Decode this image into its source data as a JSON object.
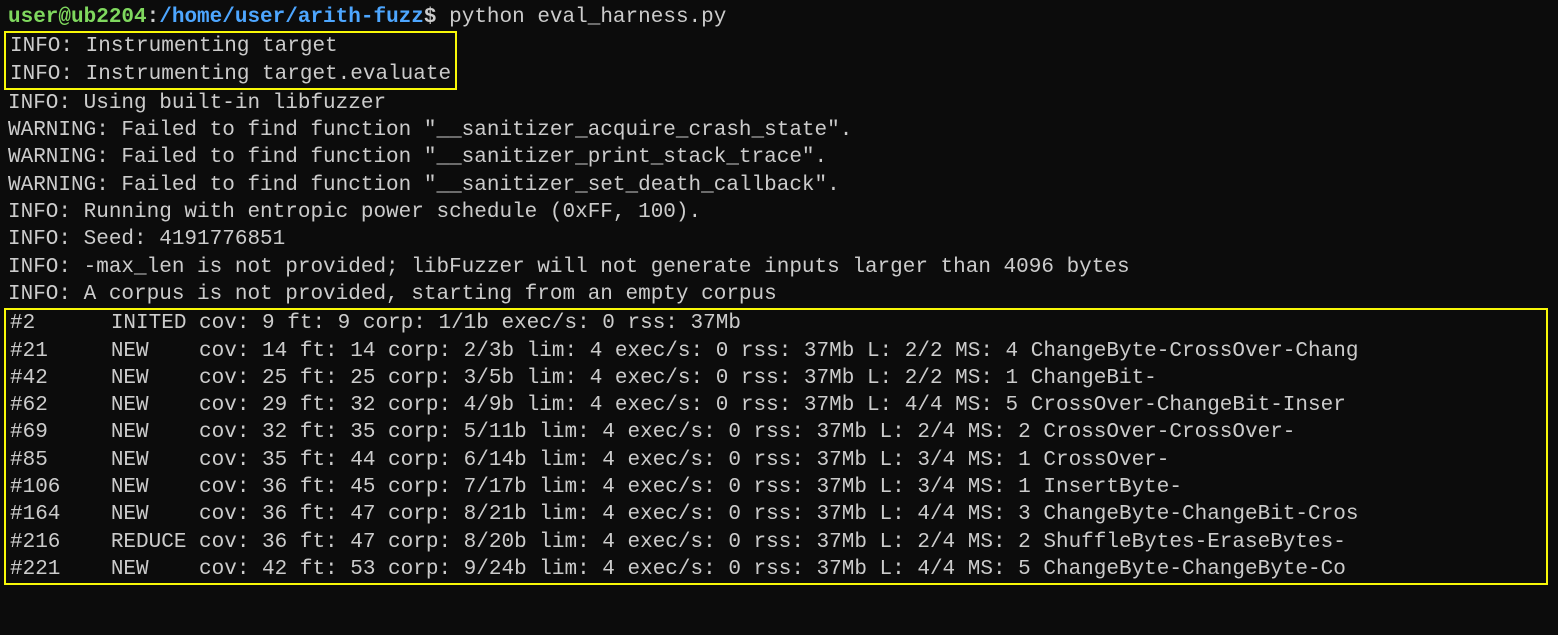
{
  "prompt": {
    "user_host": "user@ub2204",
    "colon": ":",
    "cwd": "/home/user/arith-fuzz",
    "dollar": "$ ",
    "command": "python eval_harness.py"
  },
  "box1": {
    "line1": "INFO: Instrumenting target",
    "line2": "INFO: Instrumenting target.evaluate"
  },
  "mid": {
    "l1": "INFO: Using built-in libfuzzer",
    "l2": "WARNING: Failed to find function \"__sanitizer_acquire_crash_state\".",
    "l3": "WARNING: Failed to find function \"__sanitizer_print_stack_trace\".",
    "l4": "WARNING: Failed to find function \"__sanitizer_set_death_callback\".",
    "l5": "INFO: Running with entropic power schedule (0xFF, 100).",
    "l6": "INFO: Seed: 4191776851",
    "l7": "INFO: -max_len is not provided; libFuzzer will not generate inputs larger than 4096 bytes",
    "l8": "INFO: A corpus is not provided, starting from an empty corpus"
  },
  "box2": {
    "r1": "#2      INITED cov: 9 ft: 9 corp: 1/1b exec/s: 0 rss: 37Mb",
    "r2": "#21     NEW    cov: 14 ft: 14 corp: 2/3b lim: 4 exec/s: 0 rss: 37Mb L: 2/2 MS: 4 ChangeByte-CrossOver-Chang",
    "r3": "#42     NEW    cov: 25 ft: 25 corp: 3/5b lim: 4 exec/s: 0 rss: 37Mb L: 2/2 MS: 1 ChangeBit-",
    "r4": "#62     NEW    cov: 29 ft: 32 corp: 4/9b lim: 4 exec/s: 0 rss: 37Mb L: 4/4 MS: 5 CrossOver-ChangeBit-Inser",
    "r5": "#69     NEW    cov: 32 ft: 35 corp: 5/11b lim: 4 exec/s: 0 rss: 37Mb L: 2/4 MS: 2 CrossOver-CrossOver-",
    "r6": "#85     NEW    cov: 35 ft: 44 corp: 6/14b lim: 4 exec/s: 0 rss: 37Mb L: 3/4 MS: 1 CrossOver-",
    "r7": "#106    NEW    cov: 36 ft: 45 corp: 7/17b lim: 4 exec/s: 0 rss: 37Mb L: 3/4 MS: 1 InsertByte-",
    "r8": "#164    NEW    cov: 36 ft: 47 corp: 8/21b lim: 4 exec/s: 0 rss: 37Mb L: 4/4 MS: 3 ChangeByte-ChangeBit-Cros",
    "r9": "#216    REDUCE cov: 36 ft: 47 corp: 8/20b lim: 4 exec/s: 0 rss: 37Mb L: 2/4 MS: 2 ShuffleBytes-EraseBytes-",
    "r10": "#221    NEW    cov: 42 ft: 53 corp: 9/24b lim: 4 exec/s: 0 rss: 37Mb L: 4/4 MS: 5 ChangeByte-ChangeByte-Co"
  }
}
